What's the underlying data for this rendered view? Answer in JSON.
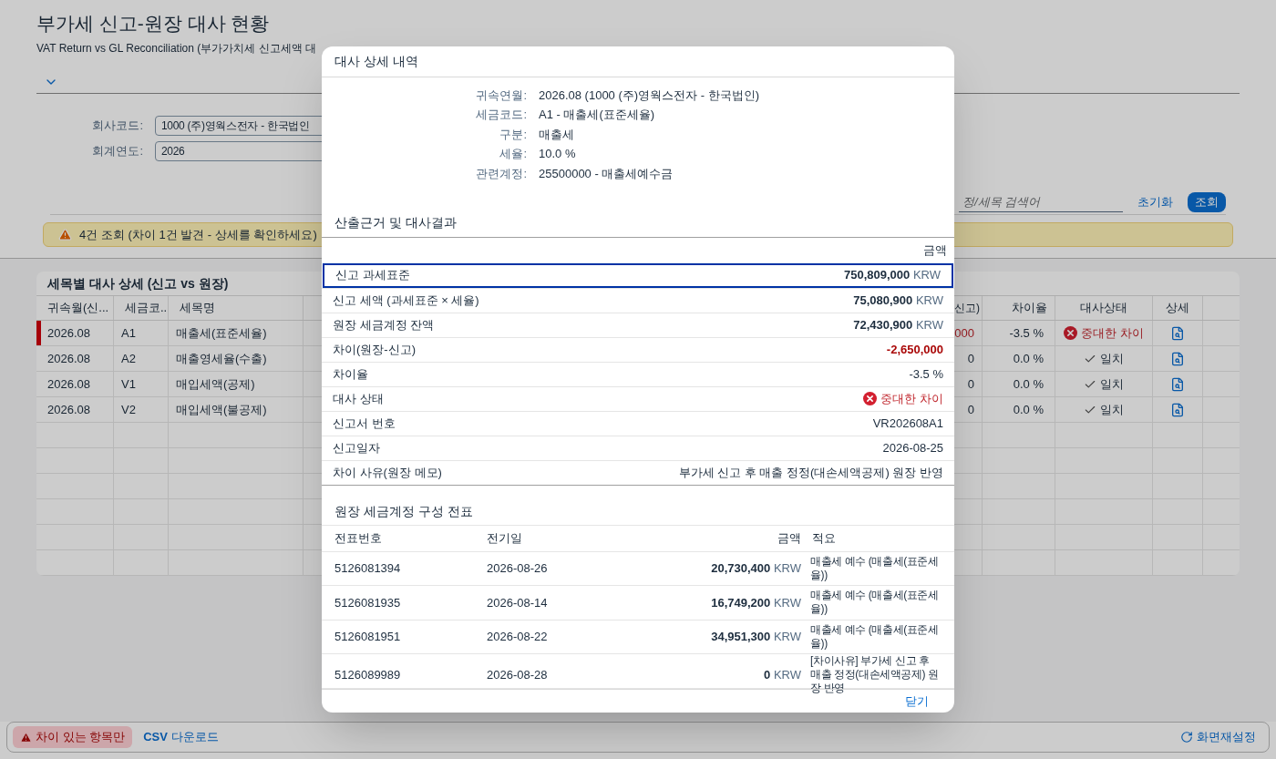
{
  "page": {
    "title": "부가세 신고-원장 대사 현황",
    "subtitle": "VAT Return vs GL Reconciliation (부가가치세 신고세액 대"
  },
  "filter": {
    "fields": [
      {
        "label": "회사코드:",
        "value": "1000 (주)영웍스전자 - 한국법인"
      },
      {
        "label": "회계연도:",
        "value": "2026"
      }
    ],
    "search": {
      "placeholder": "정/세목 검색어"
    },
    "reset_button": "초기화",
    "go_button": "조회"
  },
  "message": {
    "kind": "warning",
    "text": "4건 조회 (차이 1건 발견 - 상세를 확인하세요)"
  },
  "table": {
    "title": "세목별 대사 상세 (신고 vs 원장)",
    "columns": [
      "귀속월(신...",
      "세금코...",
      "세목명",
      "신고)",
      "차이율",
      "대사상태",
      "상세"
    ],
    "rows": [
      {
        "period": "2026.08",
        "tax_code": "A1",
        "tax_name": "매출세(표준세율)",
        "difference": ",000",
        "diff_rate": "-3.5 %",
        "status": {
          "kind": "error",
          "label": "중대한 차이"
        },
        "flagged": true
      },
      {
        "period": "2026.08",
        "tax_code": "A2",
        "tax_name": "매출영세율(수출)",
        "difference": "0",
        "diff_rate": "0.0 %",
        "status": {
          "kind": "ok",
          "label": "일치"
        },
        "flagged": false
      },
      {
        "period": "2026.08",
        "tax_code": "V1",
        "tax_name": "매입세액(공제)",
        "difference": "0",
        "diff_rate": "0.0 %",
        "status": {
          "kind": "ok",
          "label": "일치"
        },
        "flagged": false
      },
      {
        "period": "2026.08",
        "tax_code": "V2",
        "tax_name": "매입세액(불공제)",
        "difference": "0",
        "diff_rate": "0.0 %",
        "status": {
          "kind": "ok",
          "label": "일치"
        },
        "flagged": false
      }
    ]
  },
  "footer": {
    "filter_toggle": {
      "label": "차이 있는 항목만",
      "pressed": true
    },
    "csv_link": "**CSV** 다운로드",
    "reset_link": "화면재설정"
  },
  "dialog": {
    "title": "대사 상세 내역",
    "info": [
      {
        "label": "귀속연월:",
        "value": "2026.08 (1000 (주)영웍스전자 - 한국법인)"
      },
      {
        "label": "세금코드:",
        "value": "A1 - 매출세(표준세율)"
      },
      {
        "label": "구분:",
        "value": "매출세"
      },
      {
        "label": "세율:",
        "value": "10.0 %"
      },
      {
        "label": "관련계정:",
        "value": "25500000 - 매출세예수금"
      }
    ],
    "calc": {
      "title": "산출근거 및 대사결과",
      "amount_header": "금액",
      "rows": [
        {
          "label": "신고 과세표준",
          "kind": "amount",
          "value": "750,809,000",
          "unit": "KRW",
          "selected": true
        },
        {
          "label": "신고 세액 (과세표준 × 세율)",
          "kind": "amount",
          "value": "75,080,900",
          "unit": "KRW",
          "selected": false
        },
        {
          "label": "원장 세금계정 잔액",
          "kind": "amount",
          "value": "72,430,900",
          "unit": "KRW",
          "selected": false
        },
        {
          "label": "차이(원장-신고)",
          "kind": "negative",
          "value": "-2,650,000",
          "selected": false
        },
        {
          "label": "차이율",
          "kind": "text",
          "value": "-3.5 %",
          "selected": false
        },
        {
          "label": "대사 상태",
          "kind": "status_error",
          "value": "중대한 차이",
          "selected": false
        },
        {
          "label": "신고서 번호",
          "kind": "text",
          "value": "VR202608A1",
          "selected": false
        },
        {
          "label": "신고일자",
          "kind": "text",
          "value": "2026-08-25",
          "selected": false
        },
        {
          "label": "차이 사유(원장 메모)",
          "kind": "text",
          "value": "부가세 신고 후 매출 정정(대손세액공제) 원장 반영",
          "selected": false
        }
      ]
    },
    "docs": {
      "title": "원장 세금계정 구성 전표",
      "columns": [
        "전표번호",
        "전기일",
        "금액",
        "적요"
      ],
      "rows": [
        {
          "doc_no": "5126081394",
          "date": "2026-08-26",
          "amount": "20,730,400",
          "unit": "KRW",
          "text": "매출세 예수 (매출세(표준세율))"
        },
        {
          "doc_no": "5126081935",
          "date": "2026-08-14",
          "amount": "16,749,200",
          "unit": "KRW",
          "text": "매출세 예수 (매출세(표준세율))"
        },
        {
          "doc_no": "5126081951",
          "date": "2026-08-22",
          "amount": "34,951,300",
          "unit": "KRW",
          "text": "매출세 예수 (매출세(표준세율))"
        },
        {
          "doc_no": "5126089989",
          "date": "2026-08-28",
          "amount": "0",
          "unit": "KRW",
          "text": "[차이사유] 부가세 신고 후 매출 정정(대손세액공제) 원장 반영"
        }
      ]
    },
    "close_button": "닫기"
  }
}
